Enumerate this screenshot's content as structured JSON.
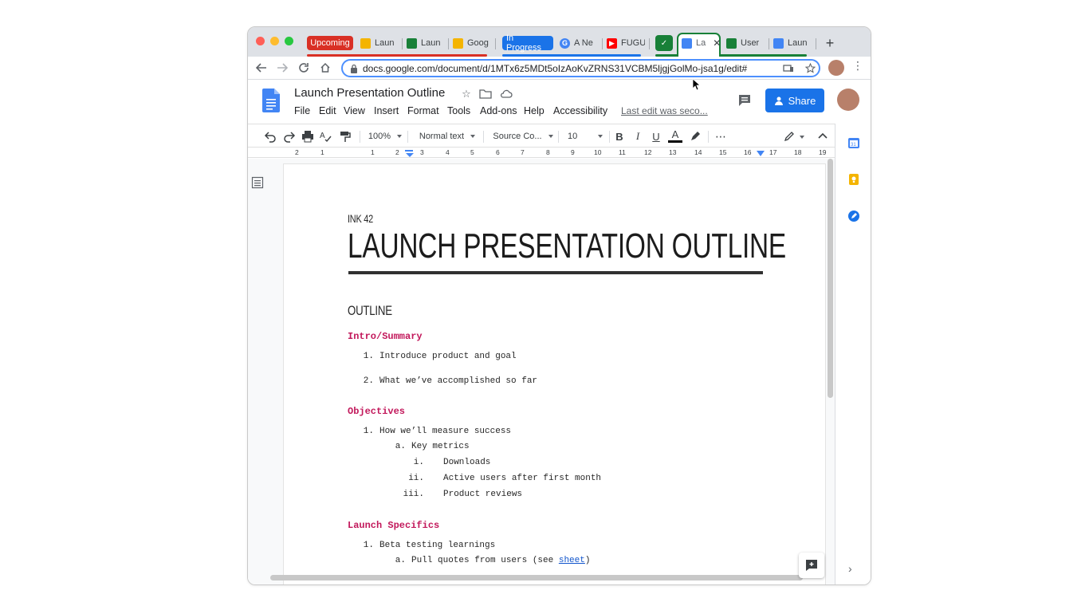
{
  "tabs": {
    "group_upcoming": "Upcoming",
    "tab1": "Laun",
    "tab2": "Laun",
    "tab3": "Goog",
    "group_inprogress": "In Progress",
    "tab4": "A Ne",
    "tab5": "FUGU",
    "tab_active": "La",
    "tab6": "User",
    "tab7": "Laun",
    "new_tab": "+"
  },
  "address": {
    "url": "docs.google.com/document/d/1MTx6z5MDt5oIzAoKvZRNS31VCBM5ljgjGolMo-jsa1g/edit#"
  },
  "docs": {
    "title": "Launch Presentation Outline",
    "menus": [
      "File",
      "Edit",
      "View",
      "Insert",
      "Format",
      "Tools",
      "Add-ons",
      "Help",
      "Accessibility"
    ],
    "last_edit": "Last edit was seco...",
    "share": "Share"
  },
  "toolbar": {
    "zoom": "100%",
    "style": "Normal text",
    "font": "Source Co...",
    "size": "10",
    "bold": "B",
    "italic": "I",
    "underline": "U",
    "text_color": "A",
    "more": "⋯"
  },
  "ruler": [
    "2",
    "1",
    "1",
    "2",
    "3",
    "4",
    "5",
    "6",
    "7",
    "8",
    "9",
    "10",
    "11",
    "12",
    "13",
    "14",
    "15",
    "16",
    "17",
    "18",
    "19"
  ],
  "page": {
    "pre_title": "INK 42",
    "title": "LAUNCH PRESENTATION OUTLINE",
    "outline_heading": "OUTLINE",
    "sections": [
      {
        "heading": "Intro/Summary",
        "items": [
          "Introduce product and goal",
          "What we’ve accomplished so far"
        ]
      },
      {
        "heading": "Objectives",
        "item1": "How we’ll measure success",
        "sub_a": "Key metrics",
        "sub_i": "Downloads",
        "sub_ii": "Active users after first month",
        "sub_iii": "Product reviews"
      },
      {
        "heading": "Launch Specifics",
        "item1": "Beta testing learnings",
        "sub_a_pre": "Pull quotes from users (see ",
        "sub_a_link": "sheet",
        "sub_a_post": ")"
      }
    ],
    "numbers": {
      "n1": "1.",
      "n2": "2.",
      "a": "a.",
      "i": "i.",
      "ii": "ii.",
      "iii": "iii."
    }
  },
  "colors": {
    "accent": "#1a73e8",
    "heading": "#c2185b",
    "group_upcoming": "#d93025",
    "group_inprogress": "#1a73e8",
    "group_green": "#188038"
  }
}
